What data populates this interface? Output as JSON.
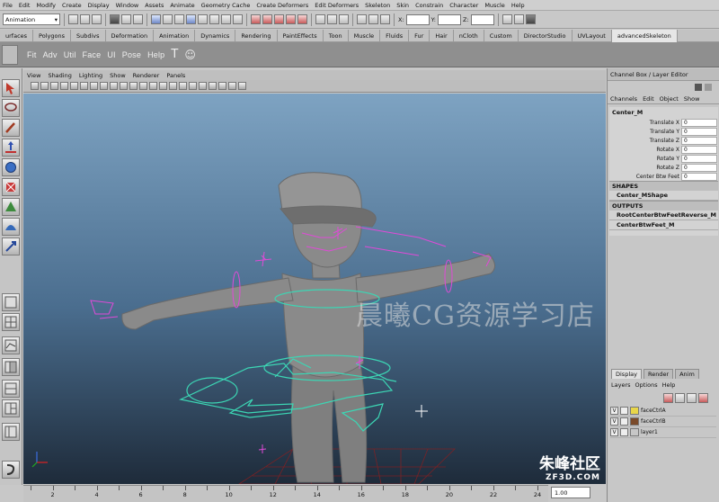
{
  "menubar": [
    "File",
    "Edit",
    "Modify",
    "Create",
    "Display",
    "Window",
    "Assets",
    "Animate",
    "Geometry Cache",
    "Create Deformers",
    "Edit Deformers",
    "Skeleton",
    "Skin",
    "Constrain",
    "Character",
    "Muscle",
    "Help"
  ],
  "statusline": {
    "mode": "Animation",
    "x_label": "X:",
    "y_label": "Y:",
    "z_label": "Z:"
  },
  "shelf_tabs": [
    "urfaces",
    "Polygons",
    "Subdivs",
    "Deformation",
    "Animation",
    "Dynamics",
    "Rendering",
    "PaintEffects",
    "Toon",
    "Muscle",
    "Fluids",
    "Fur",
    "Hair",
    "nCloth",
    "Custom",
    "DirectorStudio",
    "UVLayout",
    "advancedSkeleton"
  ],
  "shelf_buttons": [
    "Fit",
    "Adv",
    "Util",
    "Face",
    "UI",
    "Pose",
    "Help"
  ],
  "panel_menu": [
    "View",
    "Shading",
    "Lighting",
    "Show",
    "Renderer",
    "Panels"
  ],
  "watermark": "晨曦CG资源学习店",
  "logo": {
    "main": "朱峰社区",
    "sub": "ZF3D.COM"
  },
  "timeline": {
    "labels": [
      "2",
      "4",
      "6",
      "8",
      "10",
      "12",
      "14",
      "16",
      "18",
      "20",
      "22",
      "24"
    ],
    "current": "1.00"
  },
  "channel_box": {
    "title": "Channel Box / Layer Editor",
    "menu": [
      "Channels",
      "Edit",
      "Object",
      "Show"
    ],
    "node": "Center_M",
    "attributes": [
      {
        "name": "Translate X",
        "value": "0"
      },
      {
        "name": "Translate Y",
        "value": "0"
      },
      {
        "name": "Translate Z",
        "value": "0"
      },
      {
        "name": "Rotate X",
        "value": "0"
      },
      {
        "name": "Rotate Y",
        "value": "0"
      },
      {
        "name": "Rotate Z",
        "value": "0"
      },
      {
        "name": "Center Btw Feet",
        "value": "0"
      }
    ],
    "shapes_label": "SHAPES",
    "shape": "Center_MShape",
    "outputs_label": "OUTPUTS",
    "outputs": [
      "RootCenterBtwFeetReverse_M",
      "CenterBtwFeet_M"
    ]
  },
  "layer_editor": {
    "tabs": [
      "Display",
      "Render",
      "Anim"
    ],
    "menu": [
      "Layers",
      "Options",
      "Help"
    ],
    "layers": [
      {
        "v": "V",
        "name": "faceCtrlA",
        "color": "#e8d64a"
      },
      {
        "v": "V",
        "name": "faceCtrlB",
        "color": "#7a4a2a"
      },
      {
        "v": "V",
        "name": "layer1",
        "color": "#c7c7c7"
      }
    ]
  }
}
